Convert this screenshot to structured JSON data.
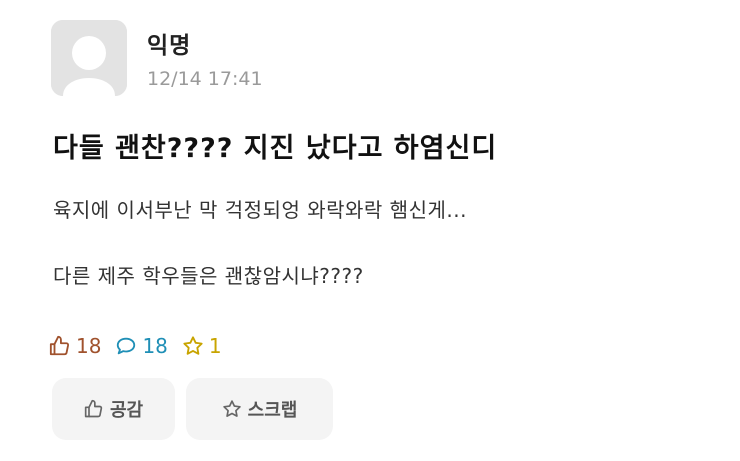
{
  "post": {
    "author": "익명",
    "timestamp": "12/14 17:41",
    "title": "다들 괜찬???? 지진 났다고 하염신디",
    "body_lines": [
      "육지에 이서부난 막 걱정되엉 와락와락 햄신게...",
      "다른 제주 학우들은 괜찮암시냐????"
    ]
  },
  "stats": {
    "likes": "18",
    "comments": "18",
    "scraps": "1"
  },
  "actions": {
    "like_label": "공감",
    "scrap_label": "스크랩"
  },
  "colors": {
    "like": "#a0522d",
    "comment": "#1f8fb6",
    "scrap": "#c8a400",
    "avatar_bg": "#e3e3e3"
  },
  "icons": {
    "like": "thumbs-up-icon",
    "comment": "speech-bubble-icon",
    "scrap": "star-icon",
    "avatar": "default-avatar-icon"
  }
}
